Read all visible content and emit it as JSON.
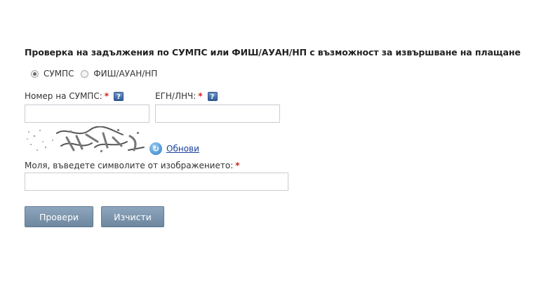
{
  "form": {
    "title": "Проверка на задължения по СУМПС или ФИШ/АУАН/НП с възможност за извършване на плащане",
    "radio_options": [
      {
        "label": "СУМПС",
        "checked": true
      },
      {
        "label": "ФИШ/АУАН/НП",
        "checked": false
      }
    ],
    "license_label": "Номер на СУМПС:",
    "egn_label": "ЕГН/ЛНЧ:",
    "required_mark": "*",
    "help_glyph": "?",
    "license_value": "",
    "egn_value": "",
    "refresh_label": "Обнови",
    "captcha_prompt": "Моля, въведете символите от изображението:",
    "captcha_value": "",
    "check_button": "Провери",
    "clear_button": "Изчисти"
  },
  "colors": {
    "required": "#cc1f1f",
    "link": "#1a3f9e",
    "button_bg": "#7d96ae",
    "help_icon": "#3f6aa6"
  },
  "icons": {
    "help": "question-help-icon",
    "refresh": "refresh-arrow-icon"
  }
}
